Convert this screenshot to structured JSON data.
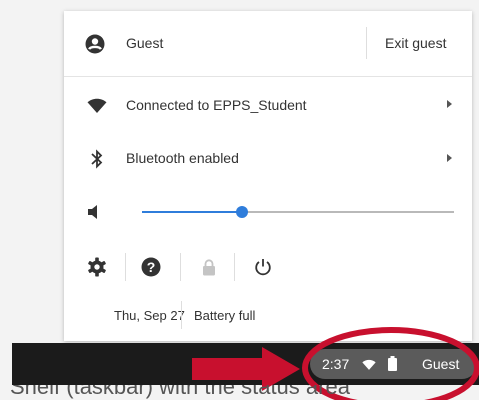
{
  "user": {
    "name": "Guest",
    "exit_label": "Exit guest"
  },
  "network": {
    "label": "Connected to EPPS_Student"
  },
  "bluetooth": {
    "label": "Bluetooth enabled"
  },
  "volume": {
    "level": 0.32
  },
  "status": {
    "date": "Thu, Sep 27",
    "battery": "Battery full"
  },
  "tray": {
    "time": "2:37",
    "user": "Guest"
  },
  "caption": {
    "text": "Shelf (taskbar) with the status area"
  },
  "colors": {
    "accent": "#2f7ddb",
    "highlight_red": "#c8102e",
    "taskbar": "#1b1b1b"
  },
  "icons": [
    "account-icon",
    "wifi-icon",
    "bluetooth-icon",
    "volume-icon",
    "settings-icon",
    "help-icon",
    "lock-icon",
    "power-icon",
    "battery-icon"
  ]
}
